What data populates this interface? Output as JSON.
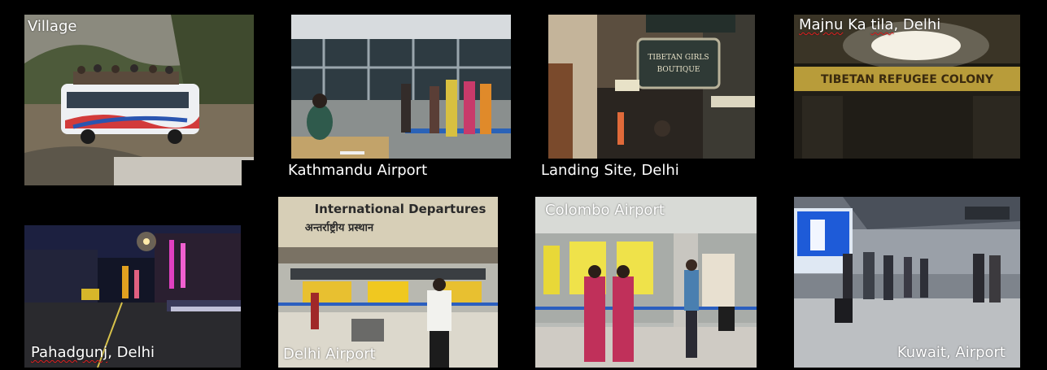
{
  "photos": [
    {
      "id": "village",
      "caption": "Village"
    },
    {
      "id": "kathmandu",
      "caption": "Kathmandu Airport"
    },
    {
      "id": "landing",
      "caption": "Landing Site, Delhi",
      "sign": "TIBETAN GIRLS BOUTIQUE"
    },
    {
      "id": "majnu",
      "caption_name": "Majnu",
      "caption_mid": " Ka ",
      "caption_tila": "tila",
      "caption_rest": ", Delhi",
      "sign": "TIBETAN REFUGEE COLONY"
    },
    {
      "id": "pahadgunj",
      "caption_name": "Pahadgunj",
      "caption_rest": ", Delhi"
    },
    {
      "id": "delhi_airport",
      "caption": "Delhi Airport",
      "sign_en": "International Departures",
      "sign_hi": "अन्तर्राष्ट्रीय प्रस्थान"
    },
    {
      "id": "colombo",
      "caption": "Colombo Airport"
    },
    {
      "id": "kuwait",
      "caption": "Kuwait, Airport"
    }
  ],
  "colors": {
    "background": "#000000",
    "caption": "#ffffff",
    "spell_underline": "#e02020"
  }
}
